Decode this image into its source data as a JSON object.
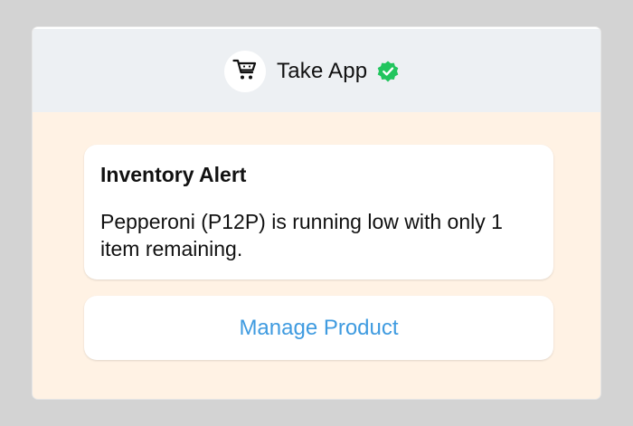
{
  "header": {
    "app_name": "Take App",
    "logo_icon": "shopping-cart-smile-icon",
    "verified_icon": "verified-badge-icon",
    "verified_color": "#22c55e"
  },
  "alert": {
    "title": "Inventory Alert",
    "message": "Pepperoni (P12P) is running low with only 1 item remaining."
  },
  "action": {
    "label": "Manage Product",
    "color": "#3f9be0"
  },
  "colors": {
    "background": "#d3d3d3",
    "header_bg": "#edf0f3",
    "panel_bg": "#fff2e4"
  }
}
